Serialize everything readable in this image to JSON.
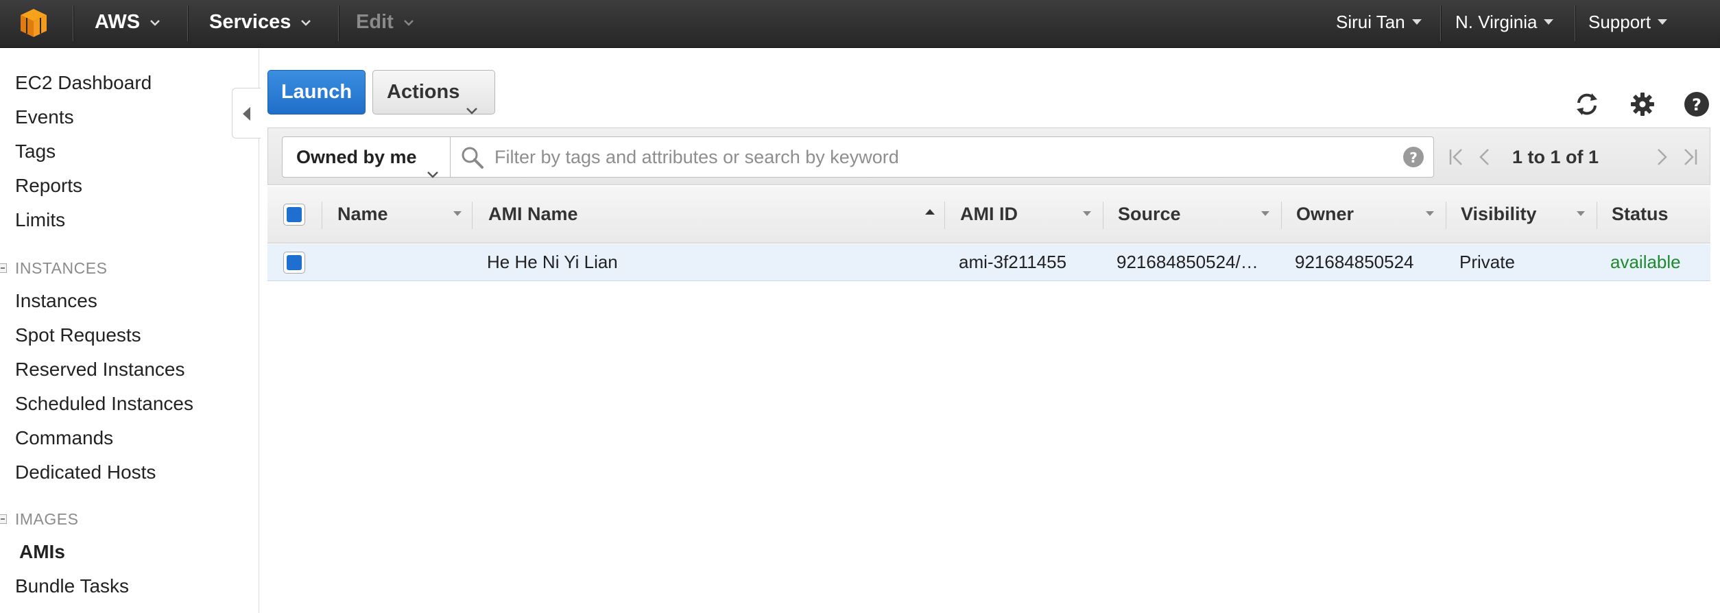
{
  "topnav": {
    "logo_icon": "aws-cube-icon",
    "brand_label": "AWS",
    "services_label": "Services",
    "edit_label": "Edit",
    "user_label": "Sirui Tan",
    "region_label": "N. Virginia",
    "support_label": "Support"
  },
  "sidebar": {
    "top_links": [
      "EC2 Dashboard",
      "Events",
      "Tags",
      "Reports",
      "Limits"
    ],
    "instances_heading": "INSTANCES",
    "instances_links": [
      "Instances",
      "Spot Requests",
      "Reserved Instances",
      "Scheduled Instances",
      "Commands",
      "Dedicated Hosts"
    ],
    "images_heading": "IMAGES",
    "images_links": [
      "AMIs",
      "Bundle Tasks"
    ],
    "active_item": "AMIs"
  },
  "toolbar": {
    "launch_label": "Launch",
    "actions_label": "Actions",
    "icons": [
      "refresh-icon",
      "gear-icon",
      "help-icon"
    ]
  },
  "filter": {
    "owner_select": "Owned by me",
    "search_placeholder": "Filter by tags and attributes or search by keyword",
    "pagination": "1 to 1 of 1"
  },
  "table": {
    "columns": [
      "Name",
      "AMI Name",
      "AMI ID",
      "Source",
      "Owner",
      "Visibility",
      "Status"
    ],
    "sorted_column": "AMI Name",
    "rows": [
      {
        "name": "",
        "ami_name": "He He Ni Yi Lian",
        "ami_id": "ami-3f211455",
        "source": "921684850524/…",
        "owner": "921684850524",
        "visibility": "Private",
        "status": "available",
        "selected": true
      }
    ]
  },
  "colors": {
    "accent_blue": "#1f6fd0",
    "status_available": "#1d8a2e",
    "topbar": "#2b2b2b"
  }
}
